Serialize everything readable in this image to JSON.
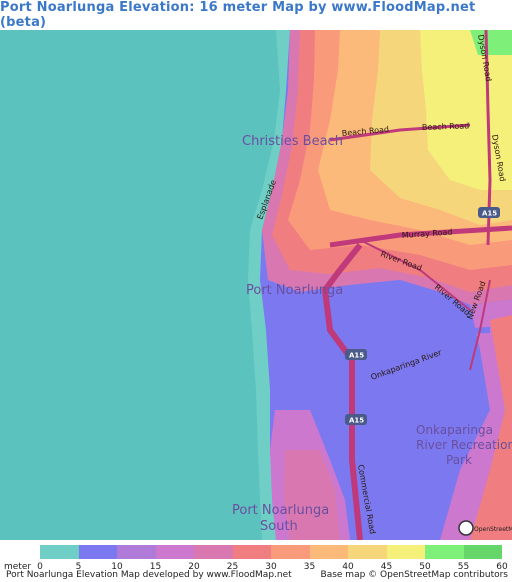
{
  "title": "Port Noarlunga Elevation: 16 meter Map by www.FloodMap.net (beta)",
  "legend": {
    "unit": "meter",
    "entries": [
      {
        "value": "0",
        "color": "#6fcfc6"
      },
      {
        "value": "5",
        "color": "#7b78f0"
      },
      {
        "value": "10",
        "color": "#b07ad8"
      },
      {
        "value": "15",
        "color": "#cc78cf"
      },
      {
        "value": "20",
        "color": "#d978b0"
      },
      {
        "value": "25",
        "color": "#f07d80"
      },
      {
        "value": "30",
        "color": "#f99b7a"
      },
      {
        "value": "35",
        "color": "#fbb97a"
      },
      {
        "value": "40",
        "color": "#f6d67a"
      },
      {
        "value": "45",
        "color": "#f4f07a"
      },
      {
        "value": "50",
        "color": "#7ef07a"
      },
      {
        "value": "55",
        "color": "#66d66a"
      },
      {
        "value": "60",
        "color": ""
      }
    ]
  },
  "footer": {
    "left": "Port Noarlunga Elevation Map developed by www.FloodMap.net",
    "right": "Base map © OpenStreetMap contributors"
  },
  "map": {
    "colors": {
      "sea": "#5bc2be",
      "shore": "#6fcfc6",
      "low": "#7b78f0",
      "purple": "#b07ad8",
      "magenta": "#cc78cf",
      "pink": "#d978b0",
      "red": "#f07d80",
      "salmon": "#f99b7a",
      "orange": "#fbb97a",
      "gold": "#f6d67a",
      "yellow": "#f4f07a",
      "green": "#7ef07a",
      "road": "#c0397a"
    },
    "places": [
      {
        "name": "Christies Beach",
        "size": "13"
      },
      {
        "name": "Port Noarlunga",
        "size": "13"
      },
      {
        "name": "Onkaparinga",
        "size": "12"
      },
      {
        "name": "River Recreation",
        "size": "12"
      },
      {
        "name": "Park",
        "size": "12"
      },
      {
        "name": "Port Noarlunga",
        "size": "13"
      },
      {
        "name": "South",
        "size": "13"
      }
    ],
    "roads": [
      {
        "name": "Beach Road"
      },
      {
        "name": "Beach Road"
      },
      {
        "name": "Dyson Road"
      },
      {
        "name": "Dyson Road"
      },
      {
        "name": "Esplanade"
      },
      {
        "name": "Murray Road"
      },
      {
        "name": "River Road"
      },
      {
        "name": "River Road"
      },
      {
        "name": "New Road"
      },
      {
        "name": "Commercial Road"
      },
      {
        "name": "Onkaparinga River"
      }
    ],
    "route_badges": [
      "A15",
      "A15",
      "A15"
    ],
    "attribution_logo": "OpenStreetMap"
  }
}
